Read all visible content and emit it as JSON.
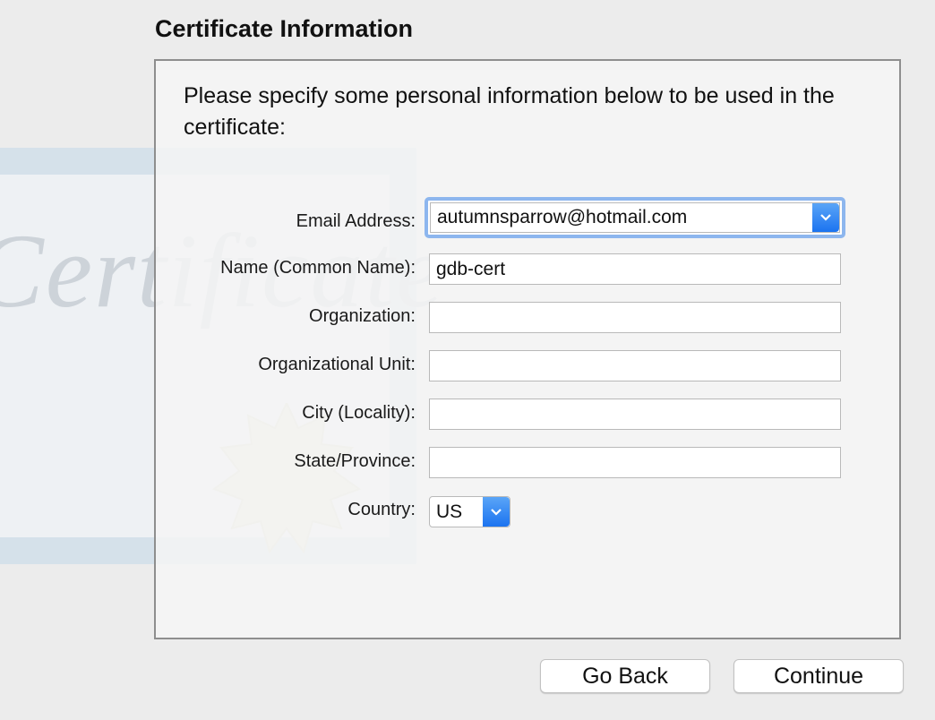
{
  "section_title": "Certificate Information",
  "intro_text": "Please specify some personal information below to be used in the certificate:",
  "background_art": {
    "script_text": "Certificate"
  },
  "fields": {
    "email": {
      "label": "Email Address:",
      "value": "autumnsparrow@hotmail.com"
    },
    "common_name": {
      "label": "Name (Common Name):",
      "value": "gdb-cert"
    },
    "organization": {
      "label": "Organization:",
      "value": ""
    },
    "org_unit": {
      "label": "Organizational Unit:",
      "value": ""
    },
    "city": {
      "label": "City (Locality):",
      "value": ""
    },
    "state": {
      "label": "State/Province:",
      "value": ""
    },
    "country": {
      "label": "Country:",
      "value": "US"
    }
  },
  "buttons": {
    "back": "Go Back",
    "continue": "Continue"
  },
  "icons": {
    "dropdown": "chevron-down-icon",
    "seal": "certificate-seal-icon"
  },
  "colors": {
    "accent": "#1b73f0",
    "focus_ring": "#8db6ee",
    "panel_border": "#8e8e8e"
  }
}
